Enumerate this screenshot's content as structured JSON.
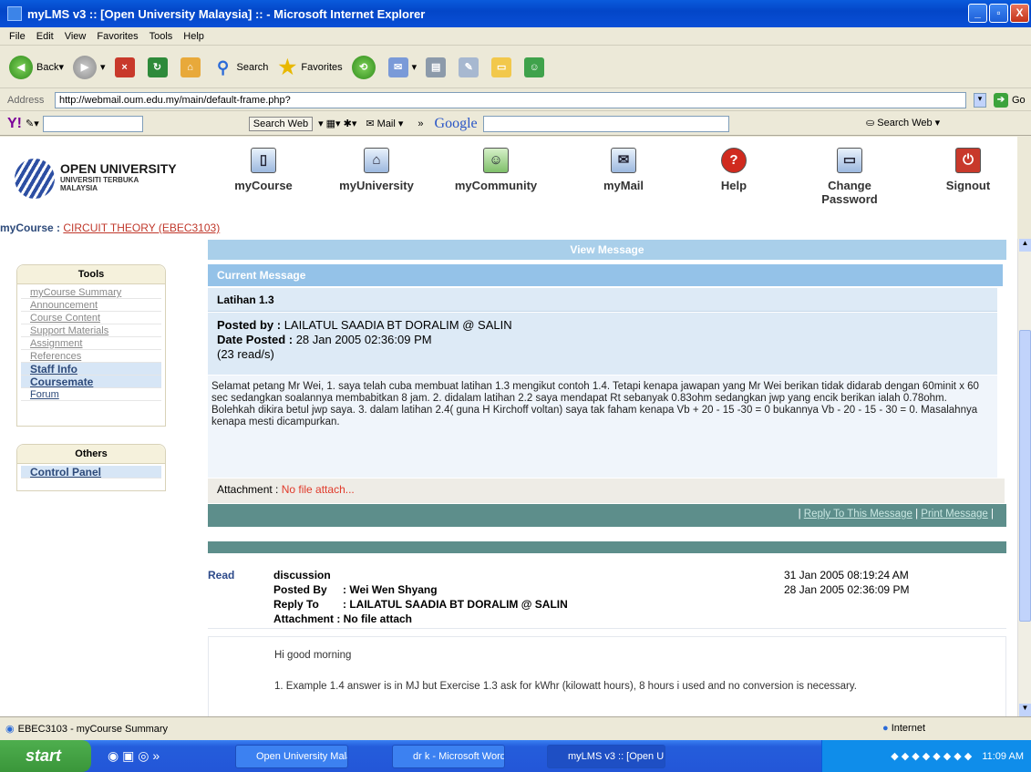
{
  "window": {
    "title": "myLMS v3 :: [Open University Malaysia] :: - Microsoft Internet Explorer",
    "minimize": "_",
    "maximize": "▫",
    "close": "X"
  },
  "menu": [
    "File",
    "Edit",
    "View",
    "Favorites",
    "Tools",
    "Help"
  ],
  "toolbar": {
    "back": "Back",
    "search": "Search",
    "favorites": "Favorites"
  },
  "address": {
    "label": "Address",
    "url": "http://webmail.oum.edu.my/main/default-frame.php?",
    "go": "Go"
  },
  "yahoo": {
    "logo": "Y!",
    "search_web": "Search Web",
    "mail": "Mail",
    "google": "Google",
    "search_web2": "Search Web"
  },
  "logo": {
    "line1": "OPEN UNIVERSITY",
    "line2": "UNIVERSITI TERBUKA",
    "line3": "MALAYSIA"
  },
  "nav": [
    {
      "label": "myCourse"
    },
    {
      "label": "myUniversity"
    },
    {
      "label": "myCommunity"
    },
    {
      "label": "myMail"
    },
    {
      "label": "Help"
    },
    {
      "label": "Change Password"
    },
    {
      "label": "Signout"
    }
  ],
  "breadcrumb": {
    "prefix": "myCourse : ",
    "course": "CIRCUIT THEORY (EBEC3103)"
  },
  "tools": {
    "title": "Tools",
    "items": [
      "myCourse Summary",
      "Announcement",
      "Course Content",
      "Support Materials",
      "Assignment",
      "References",
      "Staff Info",
      "Coursemate",
      "Forum"
    ]
  },
  "others": {
    "title": "Others",
    "items": [
      "Control Panel"
    ]
  },
  "message": {
    "view_title": "View Message",
    "current_title": "Current Message",
    "subject": "Latihan 1.3",
    "posted_by_label": "Posted by : ",
    "posted_by": "LAILATUL SAADIA BT DORALIM @ SALIN",
    "date_label": "Date Posted : ",
    "date": "28 Jan 2005 02:36:09 PM",
    "reads": "(23 read/s)",
    "body": "Selamat petang Mr Wei, 1. saya telah cuba membuat latihan 1.3 mengikut contoh 1.4. Tetapi kenapa jawapan yang Mr Wei berikan tidak didarab dengan 60minit x 60 sec sedangkan soalannya membabitkan 8 jam. 2. didalam latihan 2.2 saya mendapat Rt sebanyak 0.83ohm sedangkan jwp yang encik berikan ialah 0.78ohm. Bolehkah dikira betul jwp saya. 3. dalam latihan 2.4( guna H Kirchoff voltan) saya tak faham kenapa Vb + 20 - 15 -30 = 0 bukannya Vb - 20 - 15 - 30 = 0. Masalahnya kenapa mesti dicampurkan.",
    "attachment_label": "Attachment : ",
    "attachment": "No file attach...",
    "reply_link": "Reply To This Message",
    "print_link": "Print Message"
  },
  "reply": {
    "status": "Read",
    "subject": "discussion",
    "date1": "31 Jan 2005 08:19:24 AM",
    "posted_by_label": "Posted By",
    "posted_by": ": Wei Wen Shyang",
    "date2": "28 Jan 2005 02:36:09 PM",
    "reply_to_label": "Reply To",
    "reply_to": ": LAILATUL SAADIA BT DORALIM @ SALIN",
    "attachment": "Attachment : No file attach",
    "line1": "Hi good morning",
    "line2": "1. Example 1.4 answer is in MJ but Exercise 1.3 ask for kWhr (kilowatt hours), 8 hours i used and no conversion is necessary."
  },
  "status": {
    "text": "EBEC3103 - myCourse Summary",
    "zone": "Internet"
  },
  "taskbar": {
    "start": "start",
    "tasks": [
      "Open University Mala...",
      "dr k - Microsoft Word",
      "myLMS v3 :: [Open U..."
    ],
    "time": "11:09 AM"
  }
}
